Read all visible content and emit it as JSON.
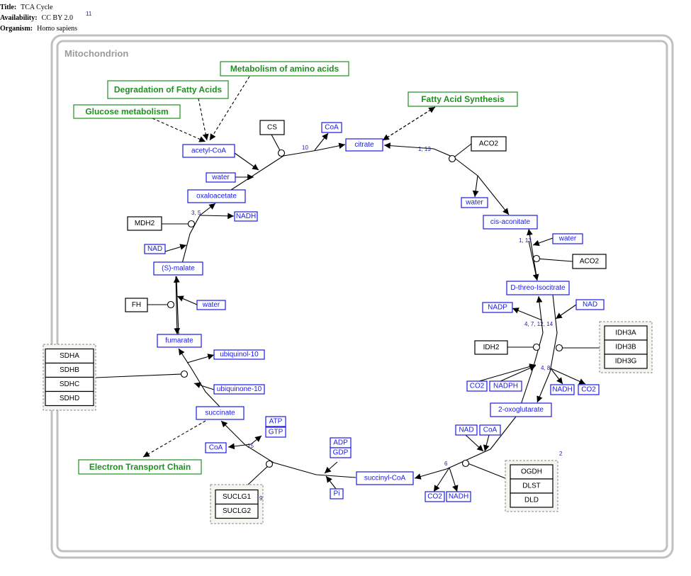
{
  "header": {
    "title_label": "Title:",
    "title_value": "TCA Cycle",
    "availability_label": "Availability:",
    "availability_value": "CC BY 2.0",
    "availability_ref": "11",
    "organism_label": "Organism:",
    "organism_value": "Homo sapiens"
  },
  "colors": {
    "metabolite": "#1a1ae6",
    "gene": "#000000",
    "pathway": "#1f8f1f",
    "compartment_border": "#c0c0c0",
    "group_fill": "#f5f5ef",
    "label": "#2020a0"
  },
  "compartment": {
    "label": "Mitochondrion"
  },
  "pathways": [
    {
      "id": "p_amino",
      "label": "Metabolism of amino acids"
    },
    {
      "id": "p_fattydeg",
      "label": "Degradation of Fatty Acids"
    },
    {
      "id": "p_glucose",
      "label": "Glucose metabolism"
    },
    {
      "id": "p_fattysyn",
      "label": "Fatty Acid Synthesis"
    },
    {
      "id": "p_etc",
      "label": "Electron Transport Chain"
    }
  ],
  "metabolites": [
    {
      "id": "m_acetylcoa",
      "label": "acetyl-CoA"
    },
    {
      "id": "m_coa1",
      "label": "CoA"
    },
    {
      "id": "m_citrate",
      "label": "citrate"
    },
    {
      "id": "m_water1",
      "label": "water"
    },
    {
      "id": "m_oxaloacetate",
      "label": "oxaloacetate"
    },
    {
      "id": "m_nadh1",
      "label": "NADH"
    },
    {
      "id": "m_nad1",
      "label": "NAD"
    },
    {
      "id": "m_malate",
      "label": "(S)-malate"
    },
    {
      "id": "m_water2",
      "label": "water"
    },
    {
      "id": "m_fumarate",
      "label": "fumarate"
    },
    {
      "id": "m_ubiquinol",
      "label": "ubiquinol-10"
    },
    {
      "id": "m_ubiquinone",
      "label": "ubiquinone-10"
    },
    {
      "id": "m_succinate",
      "label": "succinate"
    },
    {
      "id": "m_coa2",
      "label": "CoA"
    },
    {
      "id": "m_atp",
      "label": "ATP"
    },
    {
      "id": "m_gtp",
      "label": "GTP"
    },
    {
      "id": "m_adp",
      "label": "ADP"
    },
    {
      "id": "m_gdp",
      "label": "GDP"
    },
    {
      "id": "m_pi",
      "label": "Pi"
    },
    {
      "id": "m_succinylcoa",
      "label": "succinyl-CoA"
    },
    {
      "id": "m_co2a",
      "label": "CO2"
    },
    {
      "id": "m_nadh2",
      "label": "NADH"
    },
    {
      "id": "m_nad2",
      "label": "NAD"
    },
    {
      "id": "m_coa3",
      "label": "CoA"
    },
    {
      "id": "m_oxoglutarate",
      "label": "2-oxoglutarate"
    },
    {
      "id": "m_co2b",
      "label": "CO2"
    },
    {
      "id": "m_nadph",
      "label": "NADPH"
    },
    {
      "id": "m_nadh3",
      "label": "NADH"
    },
    {
      "id": "m_co2c",
      "label": "CO2"
    },
    {
      "id": "m_nadp",
      "label": "NADP"
    },
    {
      "id": "m_nad3",
      "label": "NAD"
    },
    {
      "id": "m_isocitrate",
      "label": "D-threo-Isocitrate"
    },
    {
      "id": "m_water3",
      "label": "water"
    },
    {
      "id": "m_cisaconitate",
      "label": "cis-aconitate"
    },
    {
      "id": "m_water4",
      "label": "water"
    }
  ],
  "genes": [
    {
      "id": "g_cs",
      "label": "CS"
    },
    {
      "id": "g_aco2a",
      "label": "ACO2"
    },
    {
      "id": "g_aco2b",
      "label": "ACO2"
    },
    {
      "id": "g_mdh2",
      "label": "MDH2"
    },
    {
      "id": "g_fh",
      "label": "FH"
    },
    {
      "id": "g_idh2",
      "label": "IDH2"
    }
  ],
  "groups": [
    {
      "id": "grp_sdh",
      "members": [
        "SDHA",
        "SDHB",
        "SDHC",
        "SDHD"
      ]
    },
    {
      "id": "grp_idh3",
      "members": [
        "IDH3A",
        "IDH3B",
        "IDH3G"
      ]
    },
    {
      "id": "grp_ogdh",
      "members": [
        "OGDH",
        "DLST",
        "DLD"
      ],
      "ref": "2"
    },
    {
      "id": "grp_suclg",
      "members": [
        "SUCLG1",
        "SUCLG2"
      ],
      "ref": "9"
    }
  ],
  "reaction_labels": [
    {
      "id": "r_cs",
      "label": "10"
    },
    {
      "id": "r_aco1",
      "label": "1, 13"
    },
    {
      "id": "r_aco2",
      "label": "1, 13"
    },
    {
      "id": "r_idh",
      "label": "4, 7, 12, 14"
    },
    {
      "id": "r_idh3",
      "label": "4, 8"
    },
    {
      "id": "r_ogdh",
      "label": "6"
    },
    {
      "id": "r_suclg",
      "label": "15"
    },
    {
      "id": "r_mdh",
      "label": "3, 5"
    }
  ]
}
